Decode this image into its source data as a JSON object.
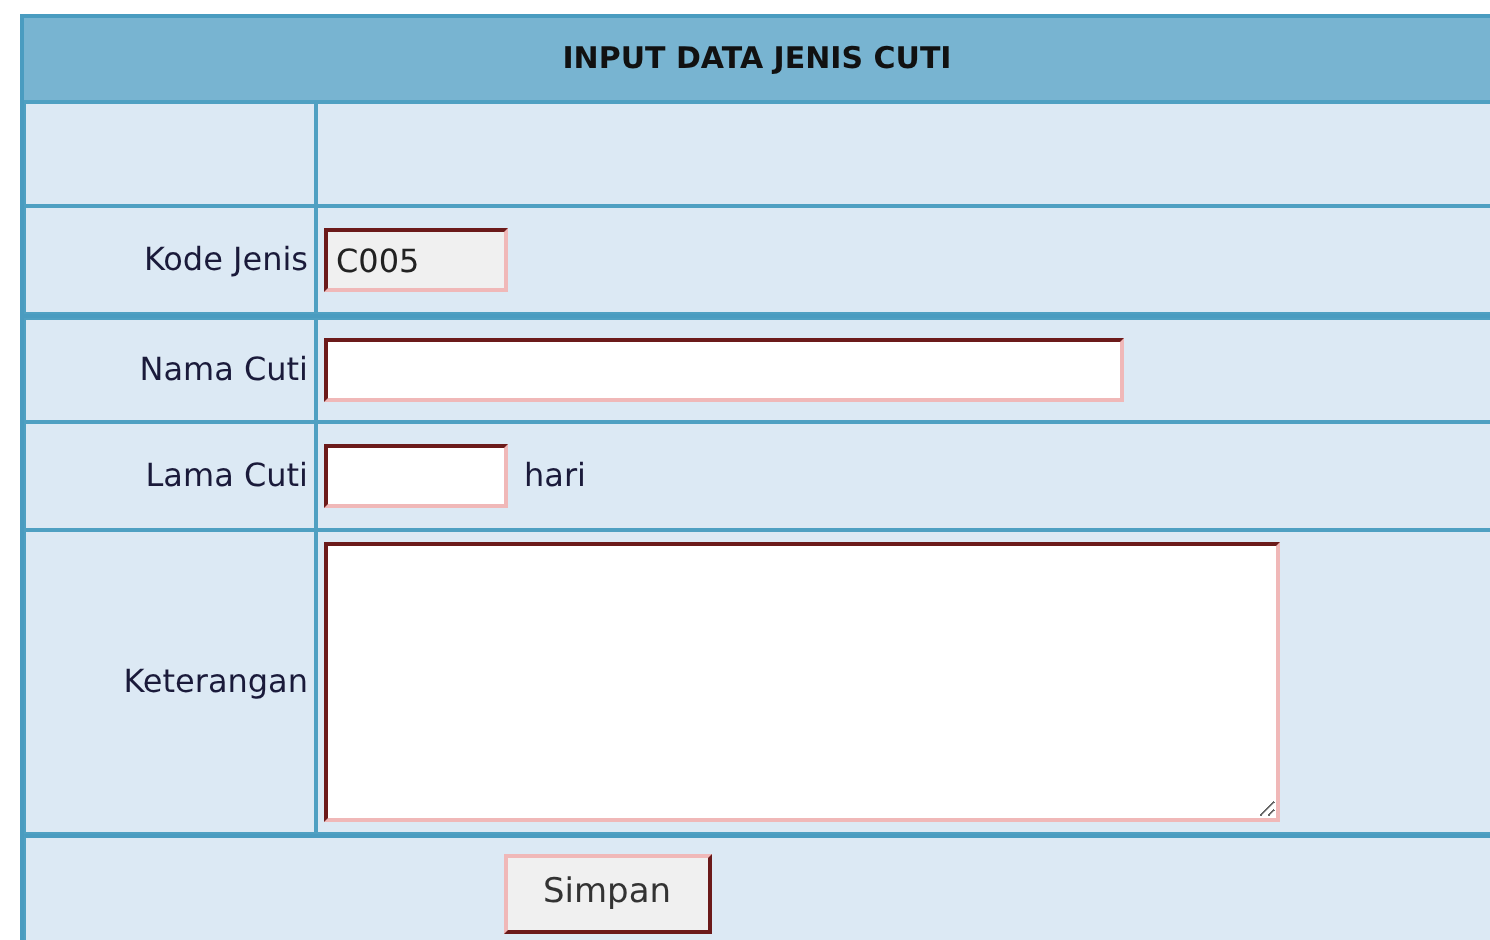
{
  "form": {
    "title": "INPUT DATA JENIS CUTI",
    "fields": [
      {
        "kind": "shorttext",
        "label": "Kode Jenis",
        "value": "C005",
        "readonly": true
      },
      {
        "kind": "longtext",
        "label": "Nama Cuti",
        "readonly": false
      },
      {
        "kind": "shorttext",
        "label": "Lama Cuti",
        "readonly": false,
        "suffix": "hari"
      },
      {
        "kind": "textarea",
        "label": "Keterangan",
        "readonly": false
      }
    ],
    "submit": "Simpan"
  }
}
